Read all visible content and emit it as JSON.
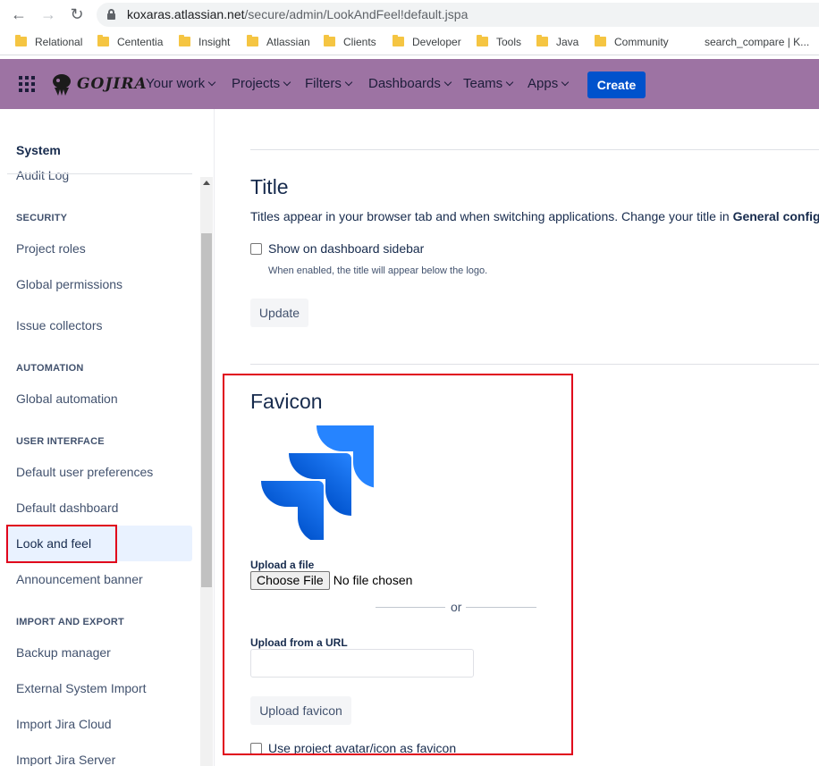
{
  "browser": {
    "url_host": "koxaras.atlassian.net",
    "url_path": "/secure/admin/LookAndFeel!default.jspa",
    "bookmarks": [
      "Relational",
      "Cententia",
      "Insight",
      "Atlassian",
      "Clients",
      "Developer",
      "Tools",
      "Java",
      "Community"
    ],
    "bookmark_extra": "search_compare | K..."
  },
  "header": {
    "logo_text": "GOJIRA",
    "nav": [
      "Your work",
      "Projects",
      "Filters",
      "Dashboards",
      "Teams",
      "Apps"
    ],
    "create_label": "Create"
  },
  "sidebar": {
    "title": "System",
    "audit_log": "Audit Log",
    "security_heading": "SECURITY",
    "project_roles": "Project roles",
    "global_permissions": "Global permissions",
    "issue_collectors": "Issue collectors",
    "automation_heading": "AUTOMATION",
    "global_automation": "Global automation",
    "ui_heading": "USER INTERFACE",
    "default_user_prefs": "Default user preferences",
    "default_dashboard": "Default dashboard",
    "look_and_feel": "Look and feel",
    "announcement_banner": "Announcement banner",
    "import_heading": "IMPORT AND EXPORT",
    "backup_manager": "Backup manager",
    "external_import": "External System Import",
    "import_cloud": "Import Jira Cloud",
    "import_server": "Import Jira Server"
  },
  "title_section": {
    "heading": "Title",
    "description": "Titles appear in your browser tab and when switching applications. Change your title in ",
    "description_bold": "General configuration",
    "checkbox_label": "Show on dashboard sidebar",
    "help": "When enabled, the title will appear below the logo.",
    "update_label": "Update"
  },
  "favicon_section": {
    "heading": "Favicon",
    "upload_file_label": "Upload a file",
    "choose_file": "Choose File",
    "no_file": "No file chosen",
    "or_text": "or",
    "upload_url_label": "Upload from a URL",
    "upload_button": "Upload favicon",
    "avatar_checkbox": "Use project avatar/icon as favicon"
  },
  "colors": {
    "header_bg": "#9d73a3",
    "create_bg": "#0052cc",
    "highlight": "#e0001b",
    "active_item_bg": "#e9f2ff"
  }
}
